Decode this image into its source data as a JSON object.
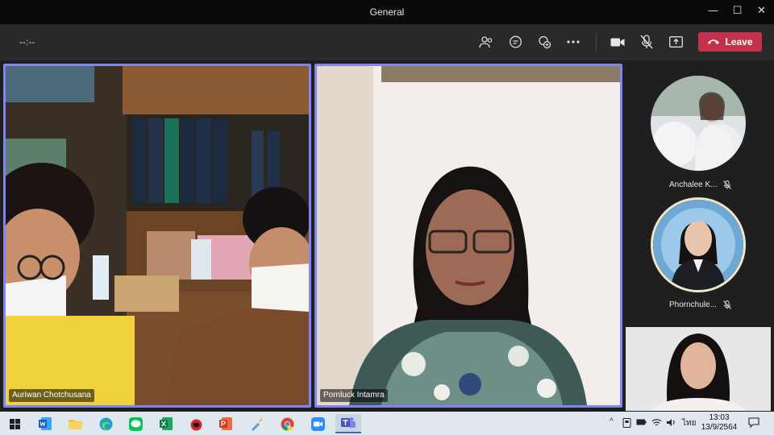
{
  "window": {
    "title": "General",
    "minimize_glyph": "—",
    "maximize_glyph": "☐",
    "close_glyph": "✕"
  },
  "toolbar": {
    "timer": "--:--",
    "icons": [
      "participants-icon",
      "chat-icon",
      "reactions-icon",
      "more-icon",
      "camera-icon",
      "mic-off-icon",
      "share-icon"
    ],
    "leave_label": "Leave",
    "leave_color": "#c4314b"
  },
  "participants": {
    "tile1_name": "Auriwan Chotchusana",
    "tile2_name": "Pornluck Intamra",
    "side1_name": "Anchalee K...",
    "side2_name": "Phornchule..."
  },
  "colors": {
    "active_border": "#7f85f5",
    "stage_bg": "#1f1f1f"
  },
  "taskbar": {
    "apps": [
      "windows-start-icon",
      "word-icon",
      "file-explorer-icon",
      "edge-icon",
      "line-icon",
      "excel-icon",
      "game-icon",
      "powerpoint-icon",
      "paint-icon",
      "chrome-icon",
      "zoom-icon",
      "teams-icon"
    ],
    "tray_caret": "^",
    "language": "ไทย",
    "time": "13:03",
    "date": "13/9/2564"
  }
}
